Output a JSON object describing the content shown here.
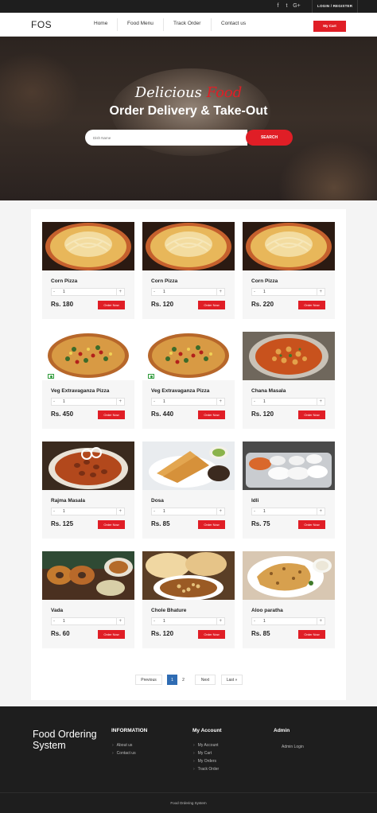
{
  "topbar": {
    "social": [
      {
        "icon": "facebook-icon",
        "glyph": "f"
      },
      {
        "icon": "twitter-icon",
        "glyph": "t"
      },
      {
        "icon": "google-plus-icon",
        "glyph": "G+"
      }
    ],
    "login_label": "LOGIN / REGISTER"
  },
  "navbar": {
    "logo": "FOS",
    "links": [
      "Home",
      "Food Menu",
      "Track Order",
      "Contact us"
    ],
    "cart_label": "My Cart"
  },
  "hero": {
    "title_script_a": "Delicious",
    "title_script_b": "Food",
    "title_main": "Order Delivery & Take-Out",
    "search_placeholder": "Dish Name",
    "search_button": "SEARCH"
  },
  "products": [
    {
      "name": "Corn Pizza",
      "qty": "1",
      "price": "Rs. 180",
      "order": "Order Now",
      "image": "pizza-pasta"
    },
    {
      "name": "Corn Pizza",
      "qty": "1",
      "price": "Rs. 120",
      "order": "Order Now",
      "image": "pizza-pasta"
    },
    {
      "name": "Corn Pizza",
      "qty": "1",
      "price": "Rs. 220",
      "order": "Order Now",
      "image": "pizza-pasta"
    },
    {
      "name": "Veg Extravaganza Pizza",
      "qty": "1",
      "price": "Rs. 450",
      "order": "Order Now",
      "image": "veg-pizza",
      "veg": true
    },
    {
      "name": "Veg Extravaganza Pizza",
      "qty": "1",
      "price": "Rs. 440",
      "order": "Order Now",
      "image": "veg-pizza",
      "veg": true
    },
    {
      "name": "Chana Masala",
      "qty": "1",
      "price": "Rs. 120",
      "order": "Order Now",
      "image": "chana-masala"
    },
    {
      "name": "Rajma Masala",
      "qty": "1",
      "price": "Rs. 125",
      "order": "Order Now",
      "image": "rajma"
    },
    {
      "name": "Dosa",
      "qty": "1",
      "price": "Rs. 85",
      "order": "Order Now",
      "image": "dosa"
    },
    {
      "name": "Idli",
      "qty": "1",
      "price": "Rs. 75",
      "order": "Order Now",
      "image": "idli"
    },
    {
      "name": "Vada",
      "qty": "1",
      "price": "Rs. 60",
      "order": "Order Now",
      "image": "vada"
    },
    {
      "name": "Chole Bhature",
      "qty": "1",
      "price": "Rs. 120",
      "order": "Order Now",
      "image": "chole-bhature"
    },
    {
      "name": "Aloo paratha",
      "qty": "1",
      "price": "Rs. 85",
      "order": "Order Now",
      "image": "aloo-paratha"
    }
  ],
  "pagination": {
    "previous": "Previous",
    "pages": [
      "1",
      "2"
    ],
    "active_page": "1",
    "next": "Next",
    "last": "Last »"
  },
  "footer": {
    "brand": "Food Ordering System",
    "columns": [
      {
        "title": "INFORMATION",
        "links": [
          "About us",
          "Contact us"
        ]
      },
      {
        "title": "My Account",
        "links": [
          "My Account",
          "My Cart",
          "My Orders",
          "Track Order"
        ]
      },
      {
        "title": "Admin",
        "links": [
          "Admin Login"
        ]
      }
    ],
    "copyright": "Food Ordering System"
  },
  "colors": {
    "accent": "#e01e26",
    "dark": "#1e1e1e",
    "page_active": "#2f6cb3"
  }
}
